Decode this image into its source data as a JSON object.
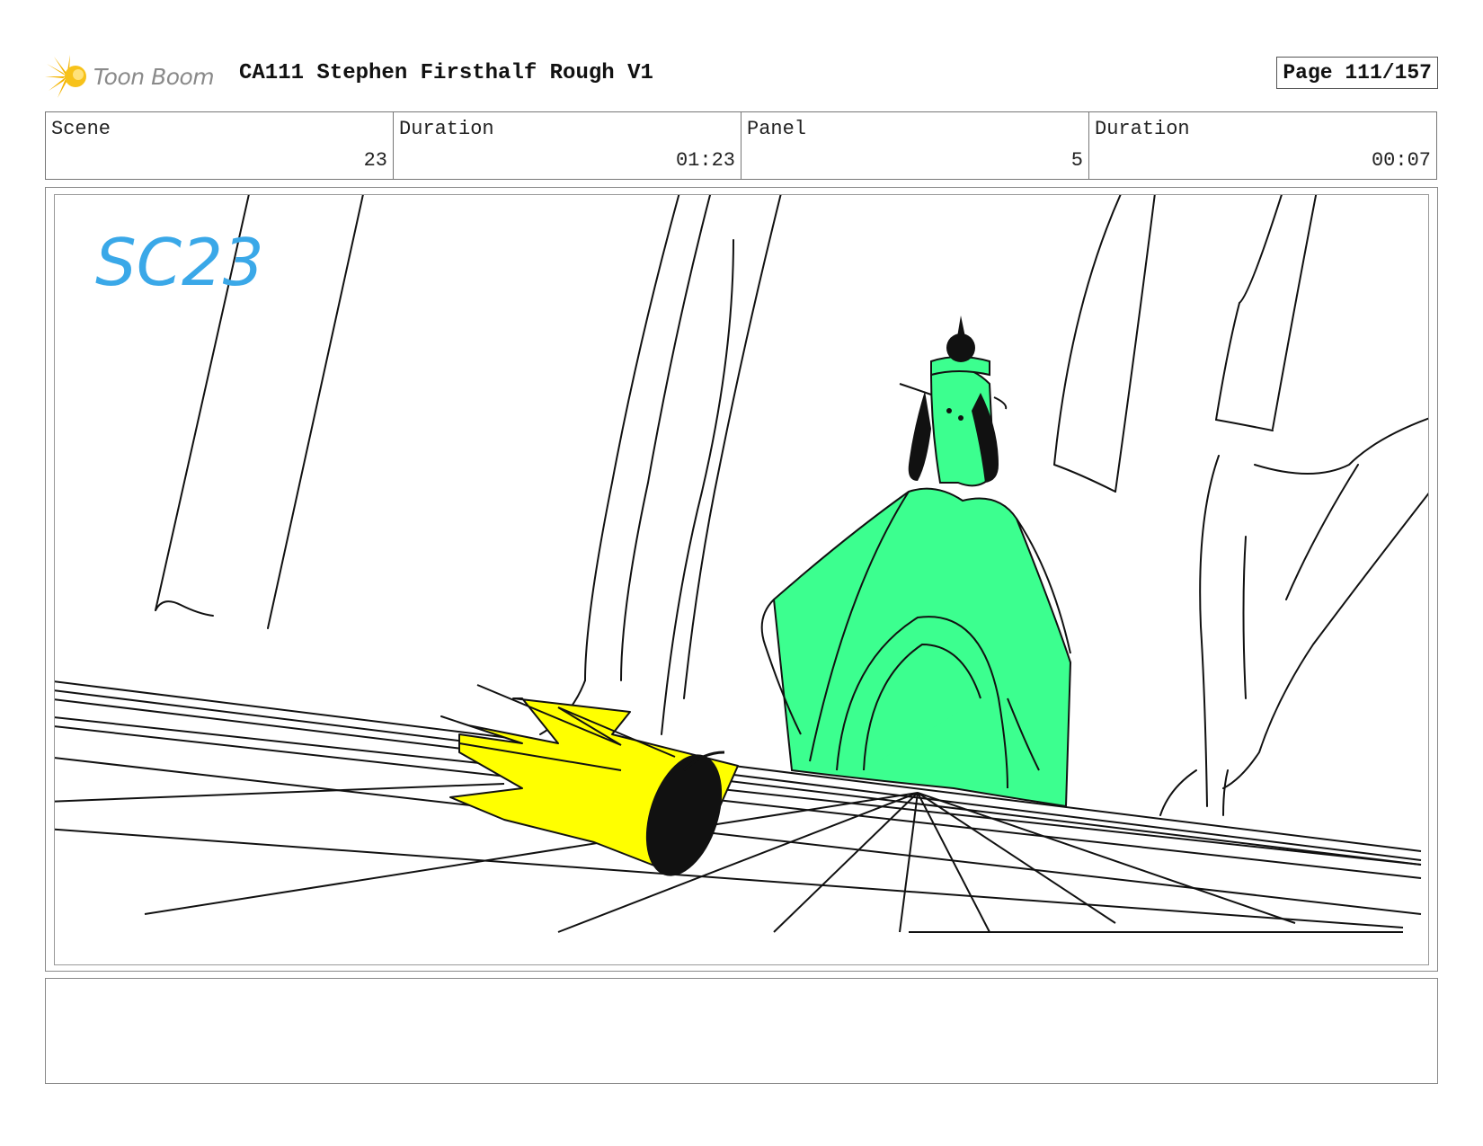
{
  "header": {
    "logo_text": "Toon Boom",
    "title": "CA111 Stephen Firsthalf Rough V1",
    "page_label": "Page 111/157"
  },
  "info": {
    "scene": {
      "label": "Scene",
      "value": "23"
    },
    "scene_duration": {
      "label": "Duration",
      "value": "01:23"
    },
    "panel": {
      "label": "Panel",
      "value": "5"
    },
    "panel_duration": {
      "label": "Duration",
      "value": "00:07"
    }
  },
  "panel_image": {
    "handwritten_label": "SC23",
    "colors": {
      "label_blue": "#3aa8e8",
      "crown_yellow": "#ffff00",
      "figure_green": "#3cff8f",
      "line_black": "#111111"
    }
  },
  "notes": {
    "text": ""
  },
  "colors": {
    "logo_orange": "#f4b400",
    "logo_text_gray": "#8a8a8a",
    "border_gray": "#777777"
  }
}
